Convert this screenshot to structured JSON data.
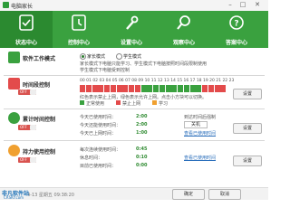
{
  "window": {
    "title": "电脑家长",
    "min": "–",
    "max": "□",
    "close": "✕"
  },
  "toolbar": {
    "items": [
      {
        "label": "状态中心",
        "icon": "status-check-icon"
      },
      {
        "label": "控制中心",
        "icon": "control-clock-icon"
      },
      {
        "label": "设置中心",
        "icon": "settings-wrench-icon"
      },
      {
        "label": "观察中心",
        "icon": "observe-magnifier-icon"
      },
      {
        "label": "答案中心",
        "icon": "answer-question-icon"
      }
    ]
  },
  "mode": {
    "title": "软件工作模式",
    "option1": "家长模式",
    "option2": "学生模式",
    "desc1": "家长模式下电脑只能学习、学生模式下电脑按照时间段限制使用",
    "desc2": "学生模式下电脑受到控制"
  },
  "time_control": {
    "title": "时间段控制",
    "switch": "OFF",
    "hour_labels": "00 01 02 03 04 05 06 07 08 09 10 11 12 13 14 15 16 17 18 19 20 21 22 23",
    "hint": "红色表示禁止上网，绿色表示允许上网。点击小方块可以切换。",
    "legend_allow": "正常使用",
    "legend_block": "禁止上网",
    "legend_other": "学习",
    "button": "设置"
  },
  "cumulative": {
    "title": "累计时间控制",
    "switch": "OFF",
    "line1_label": "今天已使用时间：",
    "line1_value": "2:00",
    "line2_label": "今天还能使用时间：",
    "line2_value": "2:00",
    "line3_label": "今天已上网时间：",
    "line3_value": "1:00",
    "right1": "到达时间后强制",
    "right2": "关机",
    "right3": "查看已使用时间",
    "button": "设置"
  },
  "continuous": {
    "title": "持力使用控制",
    "switch": "OFF",
    "line1_label": "每次连续使用时间：",
    "line1_value": "0:45",
    "line2_label": "休息时间：",
    "line2_value": "0:10",
    "line3_label": "目前已使用时间：",
    "line3_value": "0:00",
    "right1": "查看已使用时间",
    "button": "设置"
  },
  "status_bar": {
    "time": "4-13 星期五 09:38:20",
    "ok": "确定",
    "cancel": "取消",
    "watermark": "非凡软件站",
    "watermark_sub": "CRSKY.com"
  },
  "colors": {
    "toolbar": "#3aa13f",
    "toolbar_active": "#2b8a30",
    "allow": "#3aa13f",
    "block": "#e34b4b"
  },
  "hours_state": [
    "block",
    "block",
    "block",
    "block",
    "block",
    "block",
    "block",
    "block",
    "block",
    "block",
    "allow",
    "allow",
    "allow",
    "allow",
    "allow",
    "allow",
    "allow",
    "allow",
    "allow",
    "allow",
    "block",
    "block",
    "block",
    "block"
  ]
}
